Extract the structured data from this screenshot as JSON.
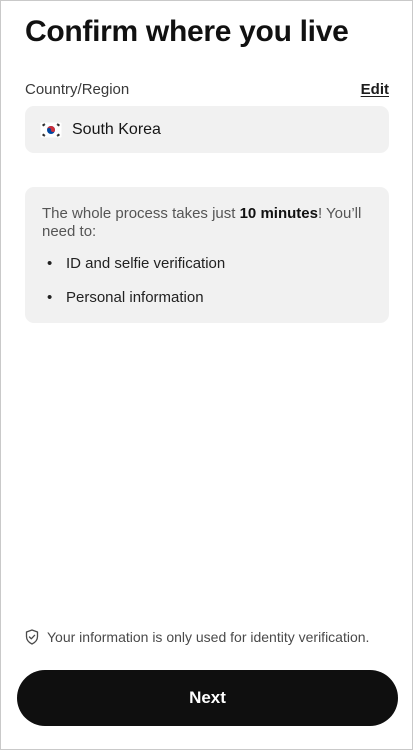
{
  "page": {
    "title": "Confirm where you live"
  },
  "country": {
    "label": "Country/Region",
    "edit_label": "Edit",
    "selected": "South Korea",
    "flag_icon": "south-korea-flag-icon"
  },
  "info": {
    "text_prefix": "The whole process takes just ",
    "text_bold": "10 minutes",
    "text_suffix": "! You’ll need to:",
    "items": [
      "ID and selfie verification",
      "Personal information"
    ],
    "bullet": "•"
  },
  "footer": {
    "privacy_icon": "shield-check-icon",
    "privacy_text": "Your information is only used for identity verification.",
    "next_label": "Next"
  },
  "colors": {
    "button_bg": "#0f0f0f",
    "card_bg": "#f1f1f1",
    "flag_red": "#cd2e3a",
    "flag_blue": "#0047a0"
  }
}
